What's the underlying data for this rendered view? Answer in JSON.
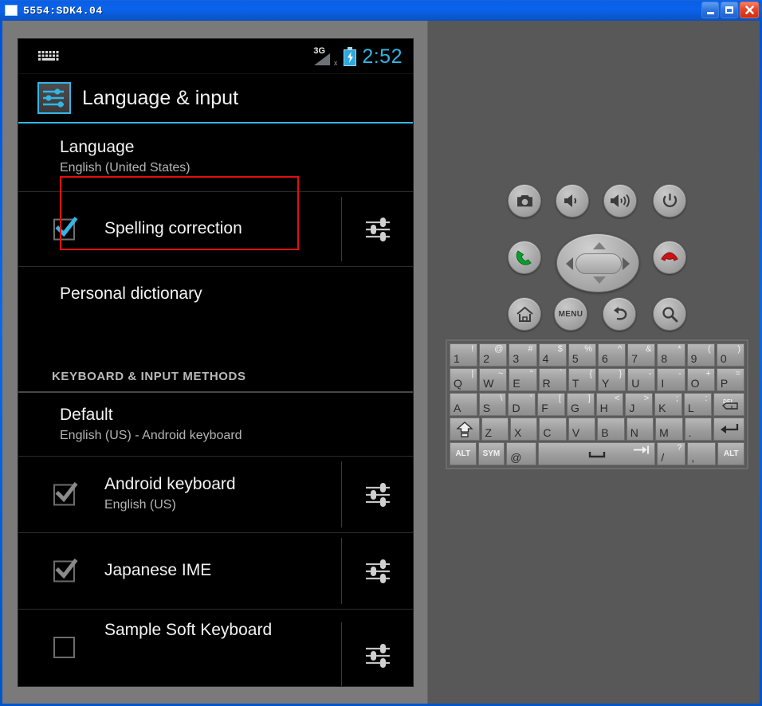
{
  "window": {
    "title": "5554:SDK4.04",
    "buttons": {
      "minimize": "Minimize",
      "maximize": "Maximize",
      "close": "Close"
    }
  },
  "phone": {
    "statusbar": {
      "notification_icon": "keyboard-icon",
      "signal": "3G",
      "signal_state": "x",
      "battery": "charging",
      "clock": "2:52"
    },
    "screen_title": "Language & input",
    "list": [
      {
        "name": "language",
        "title": "Language",
        "subtitle": "English (United States)",
        "highlighted": true,
        "checkbox": null,
        "gear": false
      },
      {
        "name": "spelling-correction",
        "title": "Spelling correction",
        "subtitle": "",
        "highlighted": false,
        "checkbox": "checked-active",
        "gear": true
      },
      {
        "name": "personal-dictionary",
        "title": "Personal dictionary",
        "subtitle": "",
        "highlighted": false,
        "checkbox": null,
        "gear": false
      },
      {
        "name": "default",
        "title": "Default",
        "subtitle": "English (US) - Android keyboard",
        "highlighted": false,
        "checkbox": null,
        "gear": false
      },
      {
        "name": "android-keyboard",
        "title": "Android keyboard",
        "subtitle": "English (US)",
        "highlighted": false,
        "checkbox": "checked-dim",
        "gear": true
      },
      {
        "name": "japanese-ime",
        "title": "Japanese IME",
        "subtitle": "",
        "highlighted": false,
        "checkbox": "checked-dim",
        "gear": true
      },
      {
        "name": "sample-soft-keyboard",
        "title": "Sample Soft Keyboard",
        "subtitle": "",
        "highlighted": false,
        "checkbox": "unchecked",
        "gear": true
      }
    ],
    "section_header": "KEYBOARD & INPUT METHODS"
  },
  "controls": {
    "buttons": [
      {
        "name": "camera-button",
        "icon": "camera-icon",
        "label": ""
      },
      {
        "name": "volume-down-button",
        "icon": "volume-down-icon",
        "label": ""
      },
      {
        "name": "volume-up-button",
        "icon": "volume-up-icon",
        "label": ""
      },
      {
        "name": "power-button",
        "icon": "power-icon",
        "label": ""
      },
      {
        "name": "call-button",
        "icon": "call-icon",
        "label": ""
      },
      {
        "name": "end-call-button",
        "icon": "end-call-icon",
        "label": ""
      },
      {
        "name": "home-button",
        "icon": "home-icon",
        "label": ""
      },
      {
        "name": "menu-button",
        "icon": "menu-icon",
        "label": "MENU"
      },
      {
        "name": "back-button",
        "icon": "back-icon",
        "label": ""
      },
      {
        "name": "search-button",
        "icon": "search-icon",
        "label": ""
      }
    ],
    "dpad": {
      "name": "dpad",
      "up": "up",
      "down": "down",
      "left": "left",
      "right": "right",
      "center": "select"
    }
  },
  "keyboard": {
    "rows": [
      [
        {
          "m": "1",
          "s": "!"
        },
        {
          "m": "2",
          "s": "@"
        },
        {
          "m": "3",
          "s": "#"
        },
        {
          "m": "4",
          "s": "$"
        },
        {
          "m": "5",
          "s": "%"
        },
        {
          "m": "6",
          "s": "^"
        },
        {
          "m": "7",
          "s": "&"
        },
        {
          "m": "8",
          "s": "*"
        },
        {
          "m": "9",
          "s": "("
        },
        {
          "m": "0",
          "s": ")"
        }
      ],
      [
        {
          "m": "Q",
          "s": "|"
        },
        {
          "m": "W",
          "s": "~"
        },
        {
          "m": "E",
          "s": "“"
        },
        {
          "m": "R",
          "s": "`"
        },
        {
          "m": "T",
          "s": "{"
        },
        {
          "m": "Y",
          "s": "}"
        },
        {
          "m": "U",
          "s": "-"
        },
        {
          "m": "I",
          "s": "-"
        },
        {
          "m": "O",
          "s": "+"
        },
        {
          "m": "P",
          "s": "="
        }
      ],
      [
        {
          "m": "A",
          "s": ""
        },
        {
          "m": "S",
          "s": "\\"
        },
        {
          "m": "D",
          "s": "'"
        },
        {
          "m": "F",
          "s": "["
        },
        {
          "m": "G",
          "s": "]"
        },
        {
          "m": "H",
          "s": "<"
        },
        {
          "m": "J",
          "s": ">"
        },
        {
          "m": "K",
          "s": ";"
        },
        {
          "m": "L",
          "s": ":"
        },
        {
          "m": "DEL",
          "s": "",
          "k": "del"
        }
      ],
      [
        {
          "m": "",
          "s": "",
          "k": "shift"
        },
        {
          "m": "Z",
          "s": ""
        },
        {
          "m": "X",
          "s": ""
        },
        {
          "m": "C",
          "s": ""
        },
        {
          "m": "V",
          "s": ""
        },
        {
          "m": "B",
          "s": ""
        },
        {
          "m": "N",
          "s": ""
        },
        {
          "m": "M",
          "s": ""
        },
        {
          "m": ".",
          "s": ""
        },
        {
          "m": "",
          "s": "",
          "k": "enter"
        }
      ],
      [
        {
          "m": "ALT",
          "s": "",
          "k": "mini"
        },
        {
          "m": "SYM",
          "s": "",
          "k": "mini"
        },
        {
          "m": "@",
          "s": ""
        },
        {
          "m": "",
          "s": "",
          "k": "space"
        },
        {
          "m": "/",
          "s": "?"
        },
        {
          "m": ",",
          "s": ""
        },
        {
          "m": "ALT",
          "s": "",
          "k": "mini"
        }
      ]
    ]
  }
}
